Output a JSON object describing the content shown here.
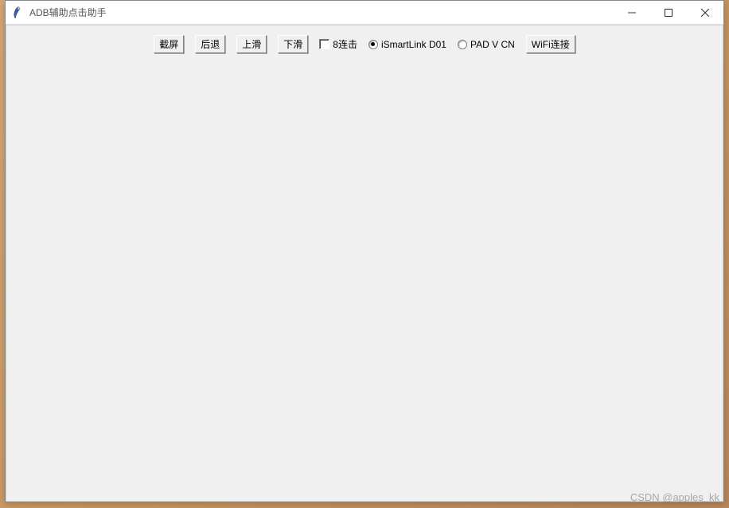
{
  "window": {
    "title": "ADB辅助点击助手"
  },
  "toolbar": {
    "screenshot_label": "截屏",
    "back_label": "后退",
    "scroll_up_label": "上滑",
    "scroll_down_label": "下滑",
    "eight_click_label": "8连击",
    "radio_ismartlink_label": "iSmartLink D01",
    "radio_pad_label": "PAD V CN",
    "wifi_connect_label": "WiFi连接"
  },
  "watermark": "CSDN @apples_kk"
}
